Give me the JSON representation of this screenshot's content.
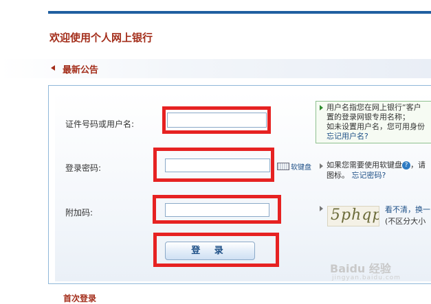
{
  "page": {
    "title": "欢迎使用个人网上银行",
    "section_title": "最新公告",
    "bottom_label": "首次登录"
  },
  "form": {
    "username_label": "证件号码或用户名:",
    "password_label": "登录密码:",
    "captcha_label": "附加码:",
    "username_value": "",
    "password_value": "",
    "captcha_value": "",
    "soft_keyboard_label": "软键盘",
    "captcha_text": "5phqp",
    "login_button": "登 录"
  },
  "hints": {
    "username_line1": "用户名指您在网上银行“客户",
    "username_line2": "置的登录网银专用名称；",
    "username_line3": "如未设置用户名，您可用身份",
    "forgot_username": "忘记用户名?",
    "password_line1": "如果您需要使用软键盘",
    "password_line1_tail": "，请",
    "password_line2": "图标。",
    "forgot_password": "忘记密码?",
    "captcha_refresh": "看不清，换一",
    "captcha_note": "(不区分大小"
  },
  "watermark": {
    "brand": "Baidu 经验",
    "url": "jingyan.baidu.com"
  },
  "colors": {
    "accent_blue": "#1f5fa0",
    "title_red": "#a32d1a",
    "highlight_red": "#e62222",
    "link_blue": "#1d4f86"
  }
}
